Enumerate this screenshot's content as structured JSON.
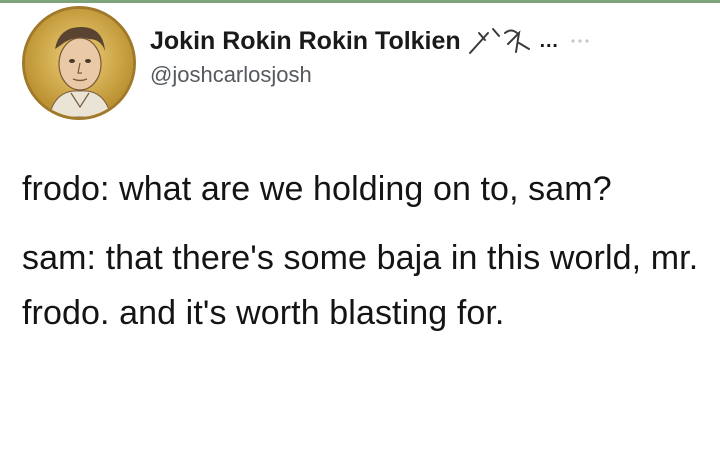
{
  "tweet": {
    "author": {
      "display_name": "Jokin Rokin Rokin Tolkien",
      "name_suffix": "…",
      "handle": "@joshcarlosjosh",
      "avatar_icon": "portrait-avatar",
      "badge_icon": "rune-glyph-icon"
    },
    "paragraphs": [
      "frodo: what are we holding on to, sam?",
      "sam: that there's some baja in this world, mr. frodo. and it's worth blasting for."
    ]
  },
  "colors": {
    "text": "#141414",
    "handle": "#555a5f",
    "avatar_ring": "#a07a2a",
    "avatar_bg": "#d6b14f"
  }
}
